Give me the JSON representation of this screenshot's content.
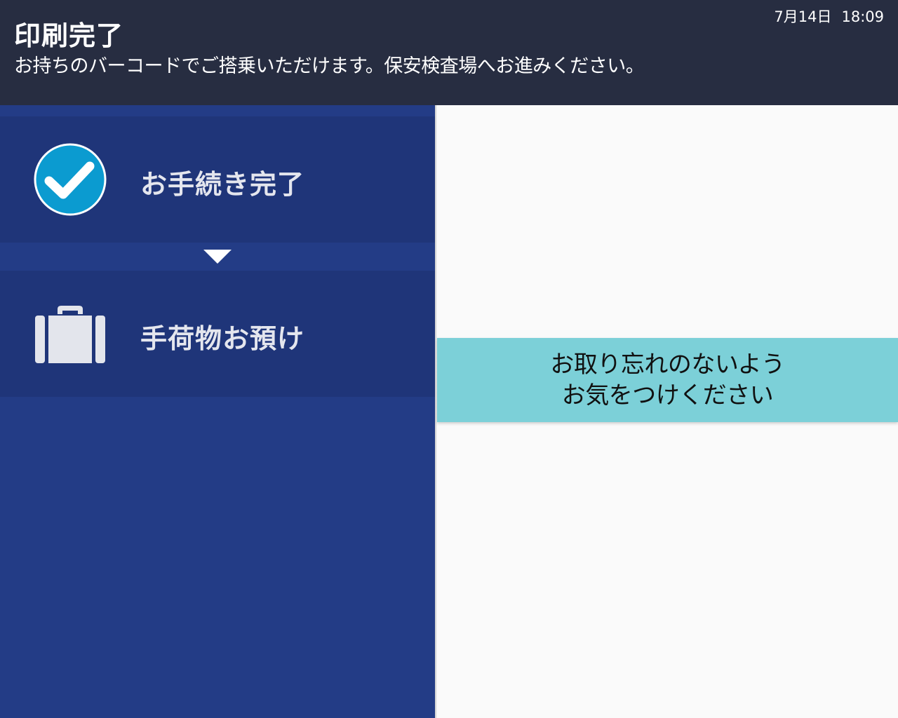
{
  "header": {
    "title": "印刷完了",
    "message": "お持ちのバーコードでご搭乗いただけます。保安検査場へお進みください。",
    "date": "7月14日",
    "time": "18:09"
  },
  "steps": [
    {
      "label": "お手続き完了",
      "icon": "check-circle-icon"
    },
    {
      "label": "手荷物お預け",
      "icon": "suitcase-icon"
    }
  ],
  "notice": {
    "line1": "お取り忘れのないよう",
    "line2": "お気をつけください"
  },
  "colors": {
    "header_bg": "#272d41",
    "sidebar_bg": "#233c86",
    "step_bg": "#1f3579",
    "check_blue": "#0b9bd0",
    "notice_bg": "#7cd0d8"
  }
}
